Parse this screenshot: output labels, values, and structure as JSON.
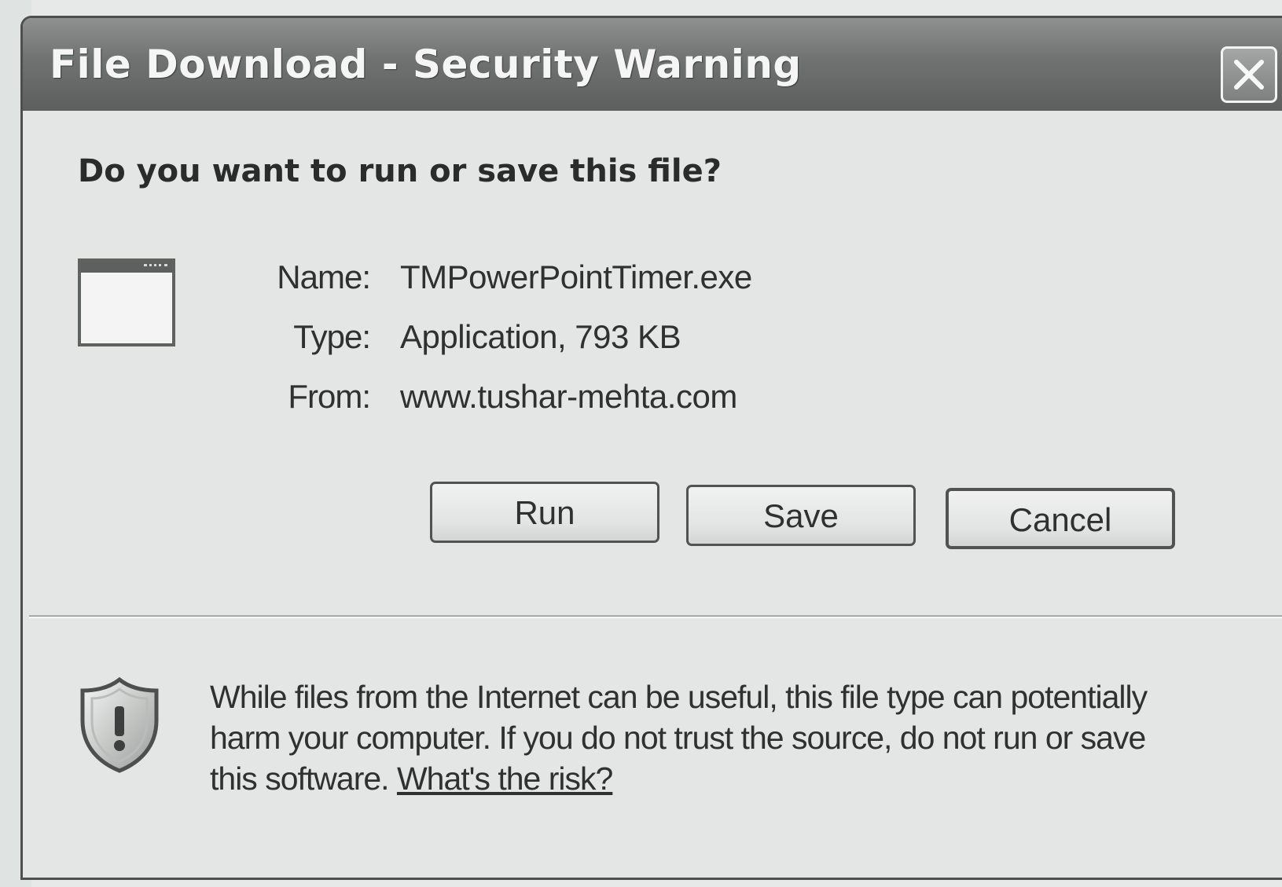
{
  "window": {
    "title": "File Download - Security Warning",
    "close_icon": "close-icon"
  },
  "dialog": {
    "question": "Do you want to run or save this file?",
    "file_icon": "application-window-icon",
    "fields": {
      "name_label": "Name:",
      "name_value": "TMPowerPointTimer.exe",
      "type_label": "Type:",
      "type_value": "Application, 793 KB",
      "from_label": "From:",
      "from_value": "www.tushar-mehta.com"
    },
    "buttons": {
      "run_label": "Run",
      "save_label": "Save",
      "cancel_label": "Cancel"
    },
    "warning": {
      "icon": "shield-warning-icon",
      "text": "While files from the Internet can be useful, this file type can potentially harm your computer. If you do not trust the source, do not run or save this software.",
      "link_text": "What's the risk?"
    }
  }
}
